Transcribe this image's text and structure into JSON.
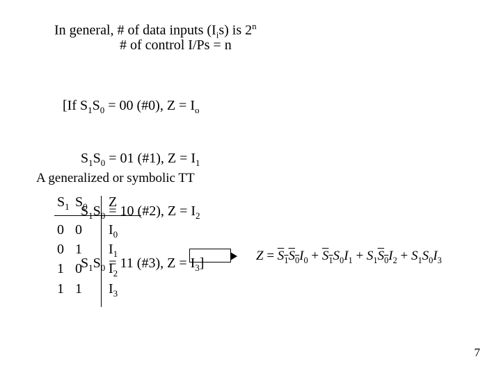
{
  "header": {
    "line1_pre": "In general, # of data inputs (I",
    "line1_sub": "i",
    "line1_mid": "s) is 2",
    "line1_sup": "n",
    "line2": "# of control I/Ps = n"
  },
  "if_block": {
    "l0a": "[If S",
    "l0s1": "1",
    "l0b": "S",
    "l0s0": "0",
    "l0c": " = 00 (#0), Z = I",
    "l0io": "o",
    "l1a": "S",
    "l1s1": "1",
    "l1b": "S",
    "l1s0": "0",
    "l1c": " = 01 (#1), Z = I",
    "l1io": "1",
    "l2a": "S",
    "l2s1": "1",
    "l2b": "S",
    "l2s0": "0",
    "l2c": " = 10 (#2), Z = I",
    "l2io": "2",
    "l3a": "S",
    "l3s1": "1",
    "l3b": "S",
    "l3s0": "0",
    "l3c": " = 11 (#3), Z = I",
    "l3io": "3",
    "l3end": "]"
  },
  "tt_caption": "A generalized or symbolic TT",
  "tt": {
    "h_s1": "S",
    "h_s1sub": "1",
    "h_s0": "S",
    "h_s0sub": "0",
    "h_z": "Z",
    "rows": [
      {
        "s1": "0",
        "s0": "0",
        "zi": "I",
        "zsub": "0"
      },
      {
        "s1": "0",
        "s0": "1",
        "zi": "I",
        "zsub": "1"
      },
      {
        "s1": "1",
        "s0": "0",
        "zi": "I",
        "zsub": "2"
      },
      {
        "s1": "1",
        "s0": "1",
        "zi": "I",
        "zsub": "3"
      }
    ]
  },
  "equation": {
    "Z": "Z",
    "eq": " = ",
    "Sbar": "S",
    "s1": "1",
    "s0": "0",
    "S": "S",
    "I": "I",
    "i0": "0",
    "i1": "1",
    "i2": "2",
    "i3": "3",
    "plus": " + "
  },
  "page_number": "7"
}
